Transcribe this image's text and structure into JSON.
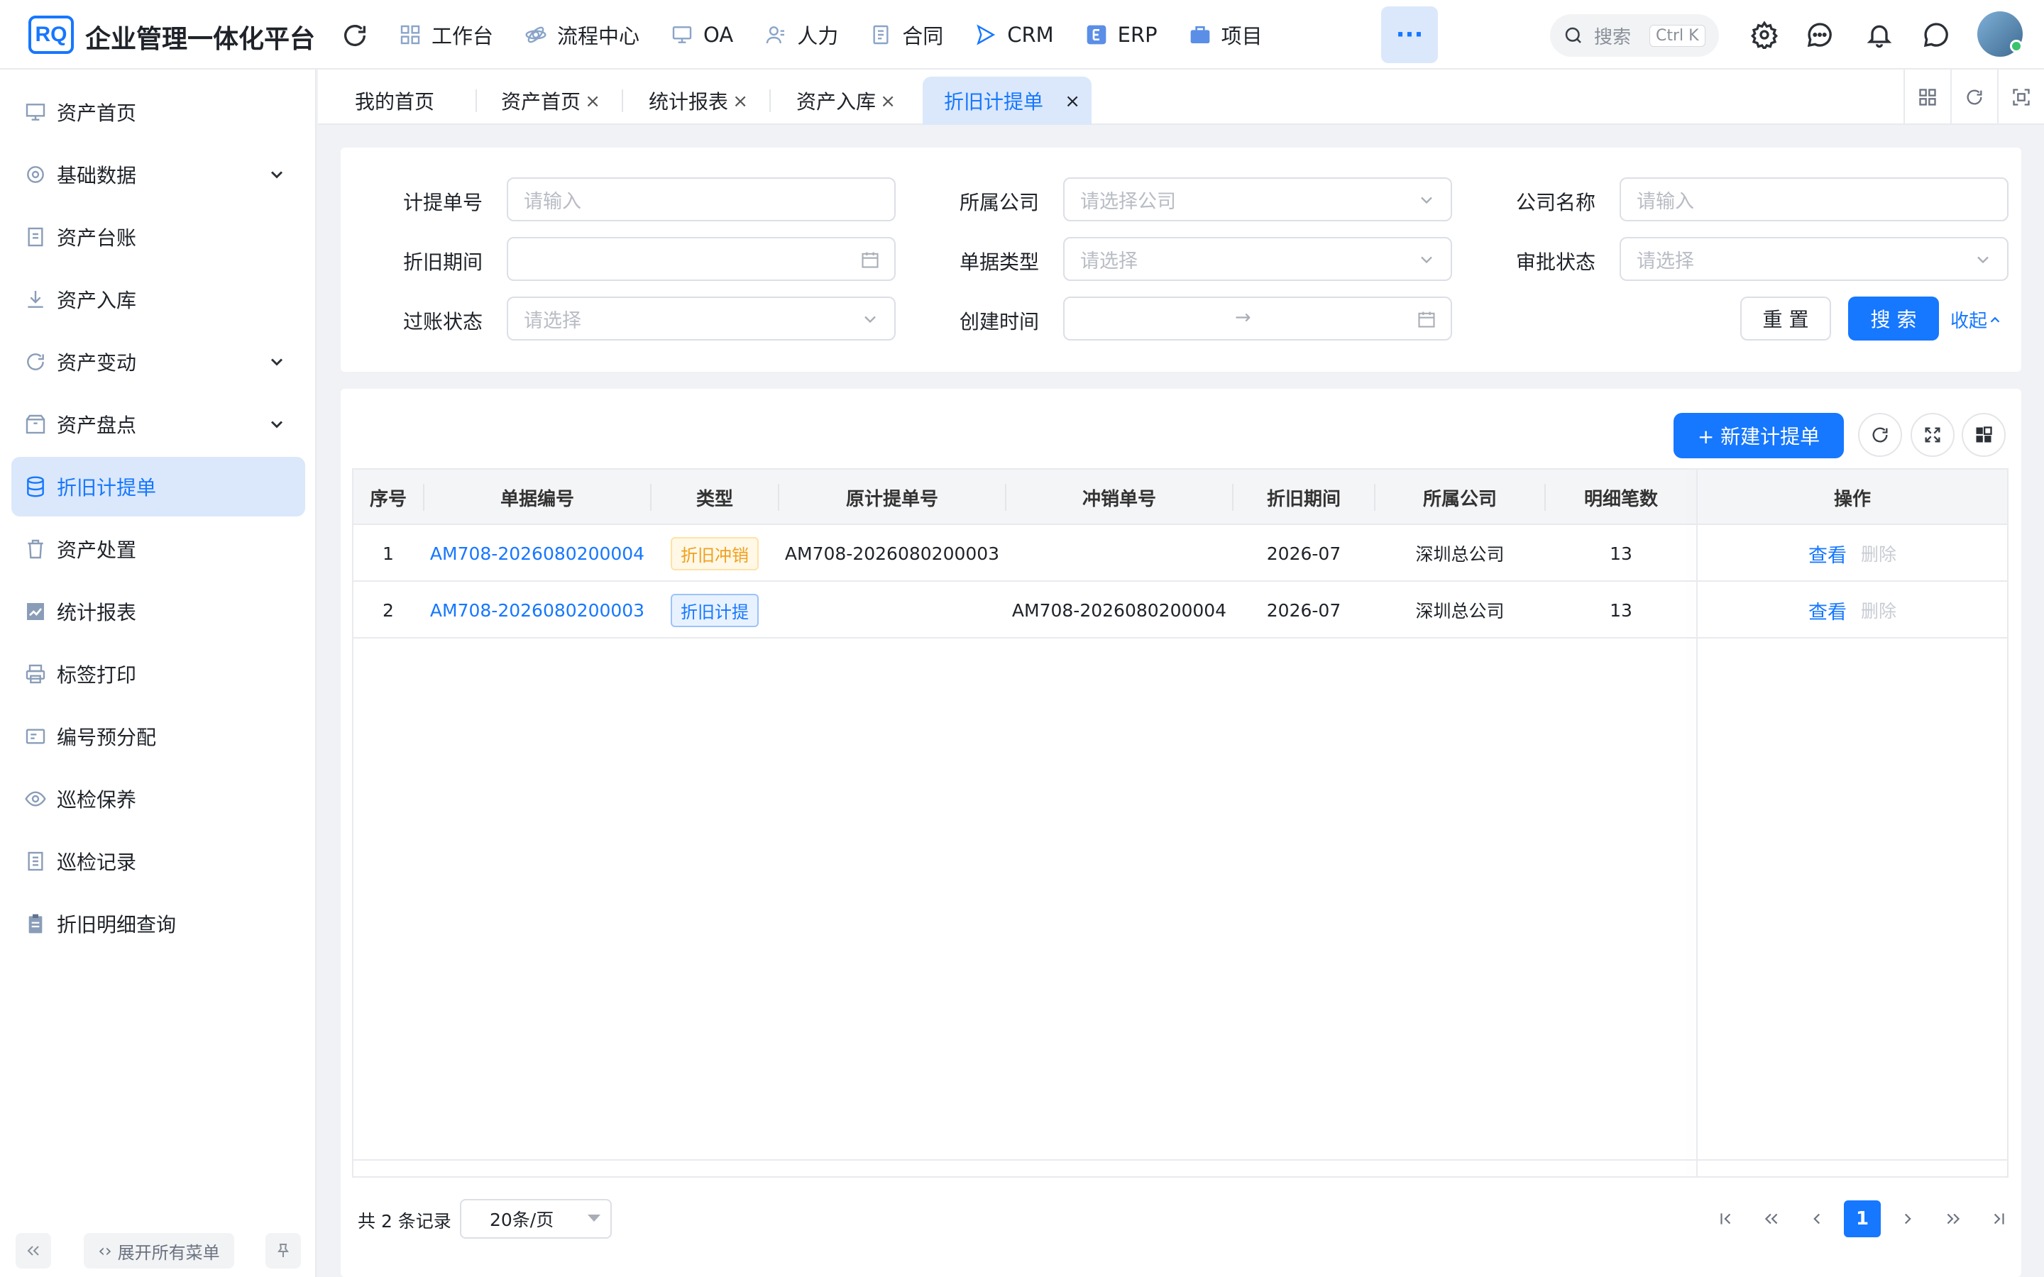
{
  "app": {
    "logo_text": "RQ",
    "title": "企业管理一体化平台"
  },
  "nav": [
    {
      "label": "工作台",
      "icon": "grid-icon"
    },
    {
      "label": "流程中心",
      "icon": "flow-icon"
    },
    {
      "label": "OA",
      "icon": "monitor-icon"
    },
    {
      "label": "人力",
      "icon": "user-icon"
    },
    {
      "label": "合同",
      "icon": "document-icon"
    },
    {
      "label": "CRM",
      "icon": "send-icon"
    },
    {
      "label": "ERP",
      "icon": "erp-icon"
    },
    {
      "label": "项目",
      "icon": "briefcase-icon"
    }
  ],
  "search": {
    "placeholder": "搜索",
    "shortcut": "Ctrl K"
  },
  "sidebar": {
    "items": [
      {
        "label": "资产首页",
        "icon": "monitor-icon",
        "expandable": false,
        "active": false
      },
      {
        "label": "基础数据",
        "icon": "gear-icon",
        "expandable": true,
        "active": false
      },
      {
        "label": "资产台账",
        "icon": "document-icon",
        "expandable": false,
        "active": false
      },
      {
        "label": "资产入库",
        "icon": "download-icon",
        "expandable": false,
        "active": false
      },
      {
        "label": "资产变动",
        "icon": "refresh-icon",
        "expandable": true,
        "active": false
      },
      {
        "label": "资产盘点",
        "icon": "box-icon",
        "expandable": true,
        "active": false
      },
      {
        "label": "折旧计提单",
        "icon": "database-icon",
        "expandable": false,
        "active": true
      },
      {
        "label": "资产处置",
        "icon": "trash-icon",
        "expandable": false,
        "active": false
      },
      {
        "label": "统计报表",
        "icon": "chart-icon",
        "expandable": false,
        "active": false
      },
      {
        "label": "标签打印",
        "icon": "printer-icon",
        "expandable": false,
        "active": false
      },
      {
        "label": "编号预分配",
        "icon": "card-icon",
        "expandable": false,
        "active": false
      },
      {
        "label": "巡检保养",
        "icon": "eye-icon",
        "expandable": false,
        "active": false
      },
      {
        "label": "巡检记录",
        "icon": "list-icon",
        "expandable": false,
        "active": false
      },
      {
        "label": "折旧明细查询",
        "icon": "clipboard-icon",
        "expandable": false,
        "active": false
      }
    ],
    "expand_all": "展开所有菜单"
  },
  "tabs": [
    {
      "label": "我的首页",
      "closable": false,
      "active": false
    },
    {
      "label": "资产首页",
      "closable": true,
      "active": false
    },
    {
      "label": "统计报表",
      "closable": true,
      "active": false
    },
    {
      "label": "资产入库",
      "closable": true,
      "active": false
    },
    {
      "label": "折旧计提单",
      "closable": true,
      "active": true
    }
  ],
  "tab_close_glyph": "×",
  "filters": {
    "f1": {
      "label": "计提单号",
      "placeholder": "请输入"
    },
    "f2": {
      "label": "所属公司",
      "placeholder": "请选择公司"
    },
    "f3": {
      "label": "公司名称",
      "placeholder": "请输入"
    },
    "f4": {
      "label": "折旧期间",
      "placeholder": ""
    },
    "f5": {
      "label": "单据类型",
      "placeholder": "请选择"
    },
    "f6": {
      "label": "审批状态",
      "placeholder": "请选择"
    },
    "f7": {
      "label": "过账状态",
      "placeholder": "请选择"
    },
    "f8": {
      "label": "创建时间",
      "placeholder": "",
      "range_sep": "→"
    },
    "reset_label": "重 置",
    "search_label": "搜 索",
    "fold_label": "收起"
  },
  "table": {
    "new_button": "+ 新建计提单",
    "columns": [
      "序号",
      "单据编号",
      "类型",
      "原计提单号",
      "冲销单号",
      "折旧期间",
      "所属公司",
      "明细笔数",
      "操作"
    ],
    "rows": [
      {
        "idx": "1",
        "doc_no": "AM708-2026080200004",
        "type": "折旧冲销",
        "type_style": "warn",
        "orig_no": "AM708-2026080200003",
        "reverse_no": "",
        "period": "2026-07",
        "company": "深圳总公司",
        "count": "13",
        "view": "查看",
        "delete": "删除"
      },
      {
        "idx": "2",
        "doc_no": "AM708-2026080200003",
        "type": "折旧计提",
        "type_style": "info",
        "orig_no": "",
        "reverse_no": "AM708-2026080200004",
        "period": "2026-07",
        "company": "深圳总公司",
        "count": "13",
        "view": "查看",
        "delete": "删除"
      }
    ]
  },
  "pager": {
    "total": "共 2 条记录",
    "page_size": "20条/页",
    "current": "1"
  },
  "colors": {
    "accent": "#1677ff",
    "active_bg": "#dbe8fb",
    "warn": "#f0a020"
  }
}
